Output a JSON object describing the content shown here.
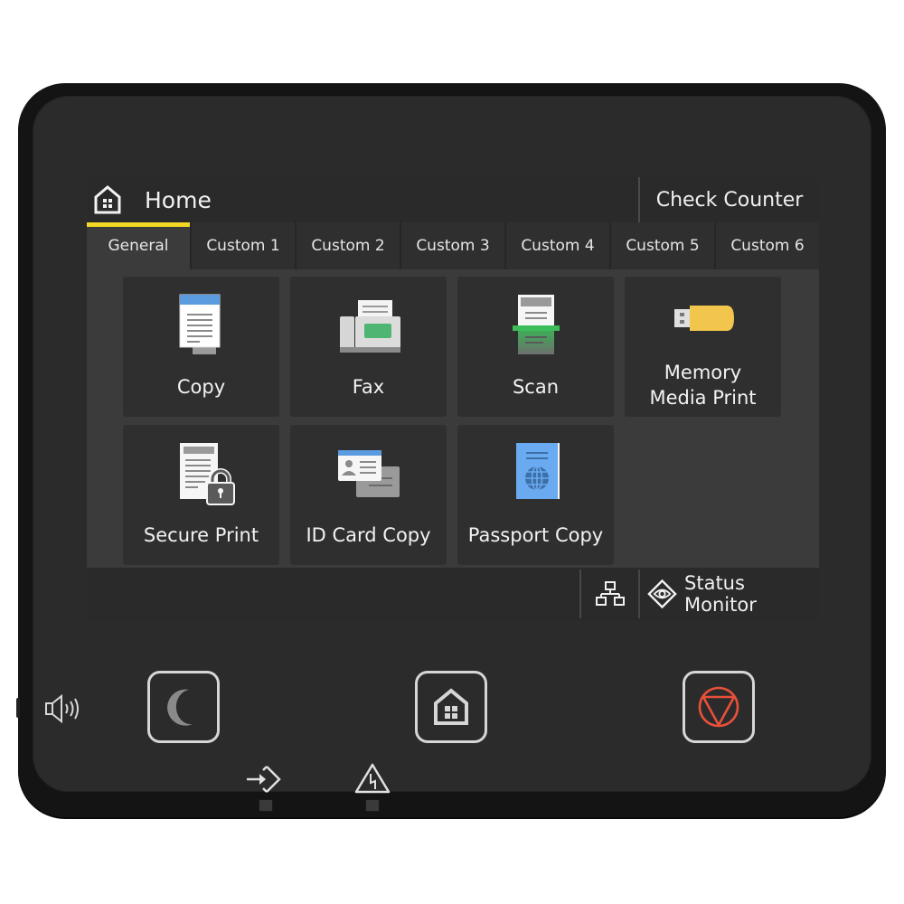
{
  "header": {
    "title": "Home",
    "title_icon": "home-icon",
    "check_counter_label": "Check Counter"
  },
  "tabs": [
    {
      "label": "General",
      "active": true
    },
    {
      "label": "Custom 1",
      "active": false
    },
    {
      "label": "Custom 2",
      "active": false
    },
    {
      "label": "Custom 3",
      "active": false
    },
    {
      "label": "Custom 4",
      "active": false
    },
    {
      "label": "Custom 5",
      "active": false
    },
    {
      "label": "Custom 6",
      "active": false
    }
  ],
  "tiles": [
    {
      "label": "Copy",
      "icon": "copy-icon"
    },
    {
      "label": "Fax",
      "icon": "fax-icon"
    },
    {
      "label": "Scan",
      "icon": "scan-icon"
    },
    {
      "label_line1": "Memory",
      "label_line2": "Media Print",
      "icon": "usb-memory-icon"
    },
    {
      "label": "Secure Print",
      "icon": "secure-print-icon"
    },
    {
      "label": "ID Card Copy",
      "icon": "id-card-icon"
    },
    {
      "label": "Passport Copy",
      "icon": "passport-icon"
    }
  ],
  "footer": {
    "network_icon": "network-icon",
    "status_monitor_label": "Status Monitor",
    "status_monitor_icon": "eye-diamond-icon"
  },
  "hardware": {
    "sleep_icon": "moon-icon",
    "home_icon": "home-icon",
    "stop_icon": "stop-icon",
    "volume_icon": "speaker-icon",
    "data_led_icon": "data-in-icon",
    "error_led_icon": "warning-icon"
  },
  "colors": {
    "active_tab_accent": "#f2d724",
    "stop_button": "#e8503a",
    "fax_screen": "#4fb572",
    "scan_bar": "#3dbd5a",
    "usb_body": "#f2c54c",
    "doc_header_blue": "#5b9be0"
  }
}
